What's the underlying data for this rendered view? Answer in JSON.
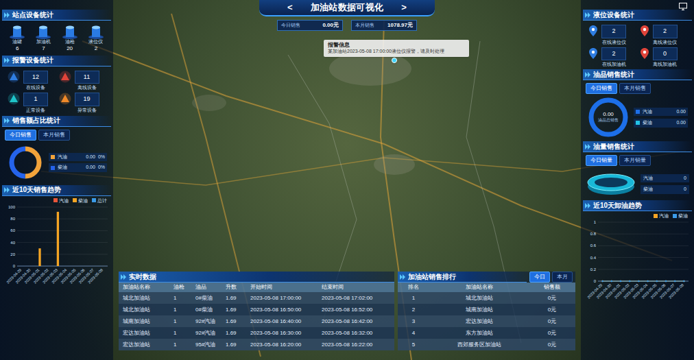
{
  "header": {
    "prev": "<",
    "title": "加油站数据可视化",
    "next": ">"
  },
  "kpis": [
    {
      "label": "今日销售",
      "value": "0.00元"
    },
    {
      "label": "本月销售",
      "value": "1078.97元"
    }
  ],
  "alert_popup": {
    "title": "报警信息",
    "text": "某加油站2023-05-08 17:00:00液位仪报警，请及时处理"
  },
  "station_devices": {
    "title": "站点设备统计",
    "items": [
      {
        "label": "油罐",
        "value": "6"
      },
      {
        "label": "加油机",
        "value": "7"
      },
      {
        "label": "油枪",
        "value": "20"
      },
      {
        "label": "液位仪",
        "value": "2"
      }
    ]
  },
  "alarm_devices": {
    "title": "报警设备统计",
    "items": [
      {
        "value": "12",
        "label": "在线设备",
        "color": "#2f7de1"
      },
      {
        "value": "11",
        "label": "离线设备",
        "color": "#e0443a"
      },
      {
        "value": "1",
        "label": "正常设备",
        "color": "#1fc4c9"
      },
      {
        "value": "19",
        "label": "异常设备",
        "color": "#f08a2a"
      }
    ]
  },
  "sales_share": {
    "title": "销售额占比统计",
    "tabs": [
      {
        "label": "今日销售",
        "selected": true
      },
      {
        "label": "本月销售",
        "selected": false
      }
    ],
    "segments": [
      {
        "level": 0.5,
        "color": "#f2a33a"
      },
      {
        "level": 0.5,
        "color": "#2563eb"
      }
    ],
    "legend": [
      {
        "name": "汽油",
        "amount": "0.00",
        "percent": "0%",
        "color": "#f2a33a"
      },
      {
        "name": "柴油",
        "amount": "0.00",
        "percent": "0%",
        "color": "#2563eb"
      }
    ]
  },
  "sales_trend": {
    "title": "近10天销售趋势",
    "y_ticks": [
      "100",
      "80",
      "60",
      "40",
      "20",
      "0"
    ],
    "y_max": 100,
    "dates": [
      "2023-04-29",
      "2023-04-30",
      "2023-05-01",
      "2023-05-02",
      "2023-05-03",
      "2023-05-04",
      "2023-05-05",
      "2023-05-06",
      "2023-05-07",
      "2023-05-08"
    ],
    "series": [
      {
        "name": "汽油",
        "color": "#e8553a",
        "values": [
          0,
          0,
          0,
          0,
          0,
          0,
          0,
          0,
          0,
          0
        ]
      },
      {
        "name": "柴油",
        "color": "#f5a524",
        "values": [
          0,
          0,
          30,
          0,
          92,
          0,
          0,
          0,
          0,
          0
        ]
      },
      {
        "name": "总计",
        "color": "#3b9be8",
        "values": [
          0,
          0,
          0,
          0,
          0,
          0,
          0,
          0,
          0,
          0
        ]
      }
    ]
  },
  "level_devices": {
    "title": "液位设备统计",
    "items": [
      {
        "value": "2",
        "label": "在线液位仪",
        "color": "#2f7de1"
      },
      {
        "value": "2",
        "label": "离线液位仪",
        "color": "#e0443a"
      },
      {
        "value": "2",
        "label": "在线加油机",
        "color": "#2f7de1"
      },
      {
        "value": "0",
        "label": "离线加油机",
        "color": "#e0443a"
      }
    ]
  },
  "oil_sales": {
    "title": "油品销售统计",
    "tabs": [
      {
        "label": "今日销售",
        "selected": true
      },
      {
        "label": "本月销售",
        "selected": false
      }
    ],
    "center_value": "0.00",
    "center_label": "油品总销售",
    "ring": [
      {
        "level": 1,
        "color": "#1d6fe8"
      }
    ],
    "legend": [
      {
        "name": "汽油",
        "value": "0.00",
        "color": "#1d6fe8"
      },
      {
        "name": "柴油",
        "value": "0.00",
        "color": "#22c3e6"
      }
    ]
  },
  "oil_volume": {
    "title": "油量销售统计",
    "tabs": [
      {
        "label": "今日销量",
        "selected": true
      },
      {
        "label": "本月销量",
        "selected": false
      }
    ],
    "legend": [
      {
        "name": "汽油",
        "value": "0"
      },
      {
        "name": "柴油",
        "value": "0"
      }
    ]
  },
  "unload_trend": {
    "title": "近10天卸油趋势",
    "y_ticks": [
      "1",
      "0.8",
      "0.6",
      "0.4",
      "0.2",
      "0"
    ],
    "y_max": 1,
    "dates": [
      "2023-04-29",
      "2023-04-30",
      "2023-05-01",
      "2023-05-02",
      "2023-05-03",
      "2023-05-04",
      "2023-05-05",
      "2023-05-06",
      "2023-05-07",
      "2023-05-08"
    ],
    "series": [
      {
        "name": "汽油",
        "color": "#f5a524",
        "values": [
          0,
          0,
          0,
          0,
          0,
          0,
          0,
          0,
          0,
          0
        ]
      },
      {
        "name": "柴油",
        "color": "#3b9be8",
        "values": [
          0,
          0,
          0,
          0,
          0,
          0,
          0,
          0,
          0,
          0
        ]
      }
    ]
  },
  "realtime": {
    "title": "实时数据",
    "columns": [
      "加油站名称",
      "油枪",
      "油品",
      "升数",
      "开始时间",
      "结束时间"
    ],
    "rows": [
      [
        "城北加油站",
        "1",
        "0#柴油",
        "1.69",
        "2023-05-08 17:00:00",
        "2023-05-08 17:02:00"
      ],
      [
        "城北加油站",
        "1",
        "0#柴油",
        "1.69",
        "2023-05-08 16:50:00",
        "2023-05-08 16:52:00"
      ],
      [
        "城南加油站",
        "1",
        "92#汽油",
        "1.69",
        "2023-05-08 16:40:00",
        "2023-05-08 16:42:00"
      ],
      [
        "宏达加油站",
        "1",
        "92#汽油",
        "1.69",
        "2023-05-08 16:30:00",
        "2023-05-08 16:32:00"
      ],
      [
        "宏达加油站",
        "1",
        "95#汽油",
        "1.69",
        "2023-05-08 16:20:00",
        "2023-05-08 16:22:00"
      ]
    ]
  },
  "ranking": {
    "title": "加油站销售排行",
    "tabs": [
      {
        "label": "今日",
        "selected": true
      },
      {
        "label": "本月",
        "selected": false
      }
    ],
    "columns": [
      "排名",
      "加油站名称",
      "销售额"
    ],
    "rows": [
      [
        "1",
        "城北加油站",
        "0元"
      ],
      [
        "2",
        "城南加油站",
        "0元"
      ],
      [
        "3",
        "宏达加油站",
        "0元"
      ],
      [
        "4",
        "东方加油站",
        "0元"
      ],
      [
        "5",
        "西郊服务区加油站",
        "0元"
      ]
    ]
  }
}
